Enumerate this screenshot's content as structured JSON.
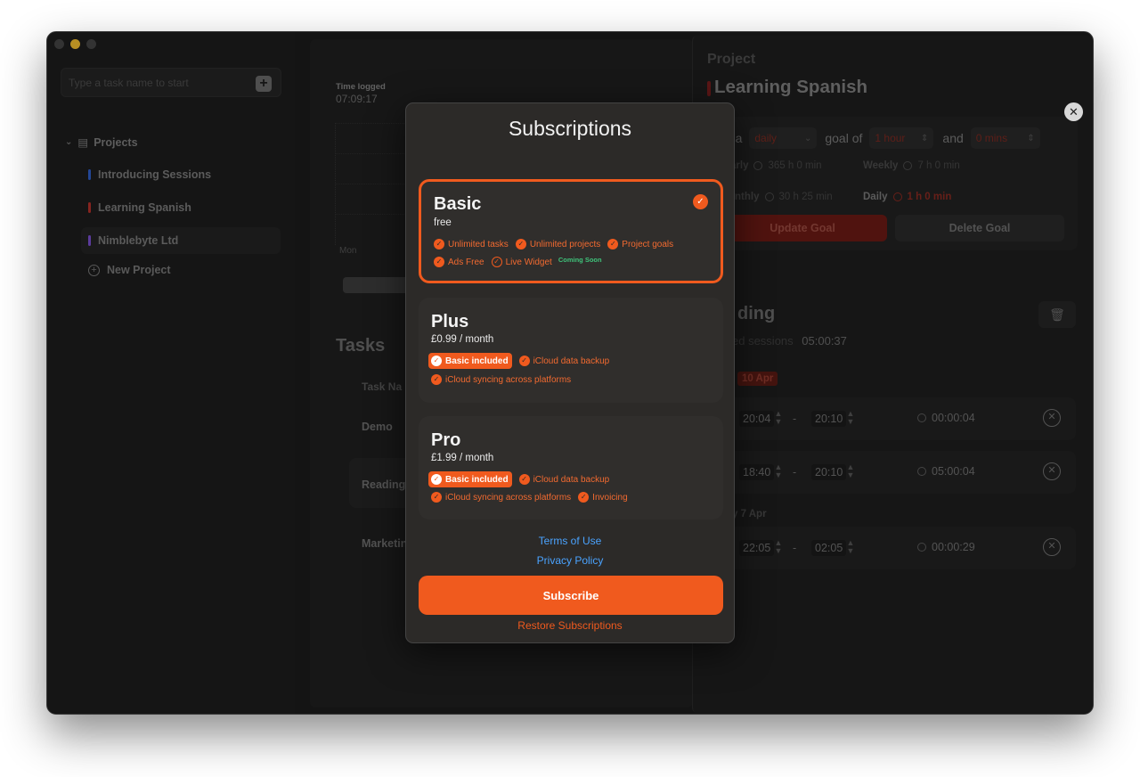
{
  "sidebar": {
    "task_input_placeholder": "Type a task name to start",
    "add_label": "+",
    "projects_header": "Projects",
    "projects": [
      {
        "label": "Introducing Sessions",
        "color": "#2f5ec9"
      },
      {
        "label": "Learning Spanish",
        "color": "#b3302a"
      },
      {
        "label": "Nimblebyte Ltd",
        "color": "#7a4fd1"
      }
    ],
    "new_project": "New Project"
  },
  "middle": {
    "time_logged_label": "Time logged",
    "time_logged_value": "07:09:17",
    "chart_day": "Mon",
    "tasks_title": "Tasks",
    "task_name_header": "Task Na",
    "tasks": [
      "Demo",
      "Reading",
      "Marketin"
    ]
  },
  "right": {
    "project_label": "Project",
    "title": "Learning Spanish",
    "goal": {
      "prefix": "et a",
      "period": "daily",
      "goal_of": "goal of",
      "hours": "1 hour",
      "and": "and",
      "mins": "0 mins"
    },
    "stats": {
      "yearly_label": "arly",
      "yearly_value": "365 h 0 min",
      "weekly_label": "Weekly",
      "weekly_value": "7 h 0 min",
      "monthly_label": "onthly",
      "monthly_value": "30 h 25 min",
      "daily_label": "Daily",
      "daily_value": "1 h 0 min"
    },
    "update_goal": "Update Goal",
    "delete_goal": "Delete Goal",
    "session_title": "ding",
    "session_sub_label": "ed sessions",
    "session_sub_total": "05:00:37",
    "date_badge": "10 Apr",
    "date_sub": "y 7 Apr",
    "sessions": [
      {
        "start": "20:04",
        "end": "20:10",
        "duration": "00:00:04"
      },
      {
        "start": "18:40",
        "end": "20:10",
        "duration": "05:00:04"
      },
      {
        "start": "22:05",
        "end": "02:05",
        "duration": "00:00:29"
      }
    ]
  },
  "modal": {
    "title": "Subscriptions",
    "plans": {
      "basic": {
        "name": "Basic",
        "price": "free",
        "features": [
          "Unlimited tasks",
          "Unlimited projects",
          "Project goals",
          "Ads Free",
          "Live Widget"
        ],
        "coming_soon": "Coming Soon"
      },
      "plus": {
        "name": "Plus",
        "price": "£0.99 / month",
        "included": "Basic included",
        "features": [
          "iCloud data backup",
          "iCloud syncing across platforms"
        ]
      },
      "pro": {
        "name": "Pro",
        "price": "£1.99 / month",
        "included": "Basic included",
        "features": [
          "iCloud data backup",
          "iCloud syncing across platforms",
          "Invoicing"
        ]
      }
    },
    "terms": "Terms of Use",
    "privacy": "Privacy Policy",
    "subscribe": "Subscribe",
    "restore": "Restore Subscriptions"
  },
  "colors": {
    "accent": "#f05a1e",
    "link": "#4aa3ff",
    "coming_soon": "#3fc27a"
  }
}
